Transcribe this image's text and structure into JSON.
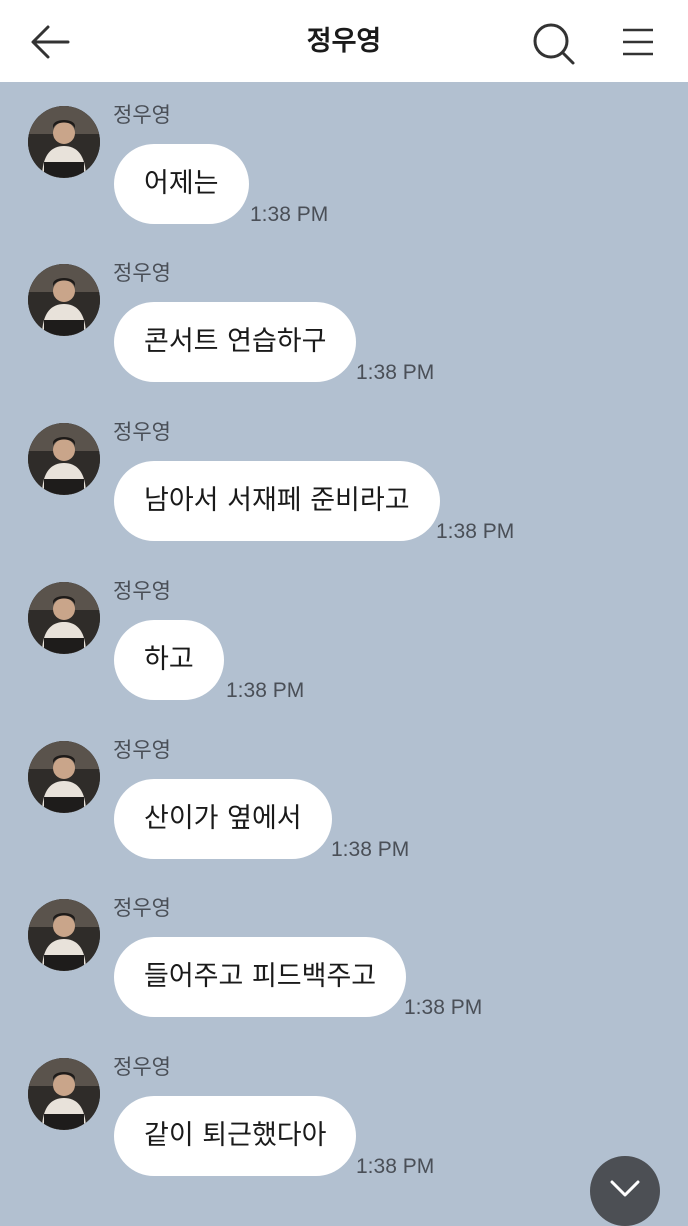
{
  "header": {
    "title": "정우영",
    "back_icon": "back-arrow-icon",
    "search_icon": "search-icon",
    "menu_icon": "hamburger-menu-icon"
  },
  "messages": [
    {
      "sender": "정우영",
      "text": "어제는",
      "time": "1:38 PM"
    },
    {
      "sender": "정우영",
      "text": "콘서트 연습하구",
      "time": "1:38 PM"
    },
    {
      "sender": "정우영",
      "text": "남아서 서재페 준비라고",
      "time": "1:38 PM"
    },
    {
      "sender": "정우영",
      "text": "하고",
      "time": "1:38 PM"
    },
    {
      "sender": "정우영",
      "text": "산이가 옆에서",
      "time": "1:38 PM"
    },
    {
      "sender": "정우영",
      "text": "들어주고 피드백주고",
      "time": "1:38 PM"
    },
    {
      "sender": "정우영",
      "text": "같이 퇴근했다아",
      "time": "1:38 PM"
    }
  ],
  "colors": {
    "background": "#b2c0d0",
    "bubble": "#ffffff",
    "header": "#ffffff",
    "scroll_button": "#4c4f54"
  },
  "scroll_down_icon": "chevron-down-icon"
}
